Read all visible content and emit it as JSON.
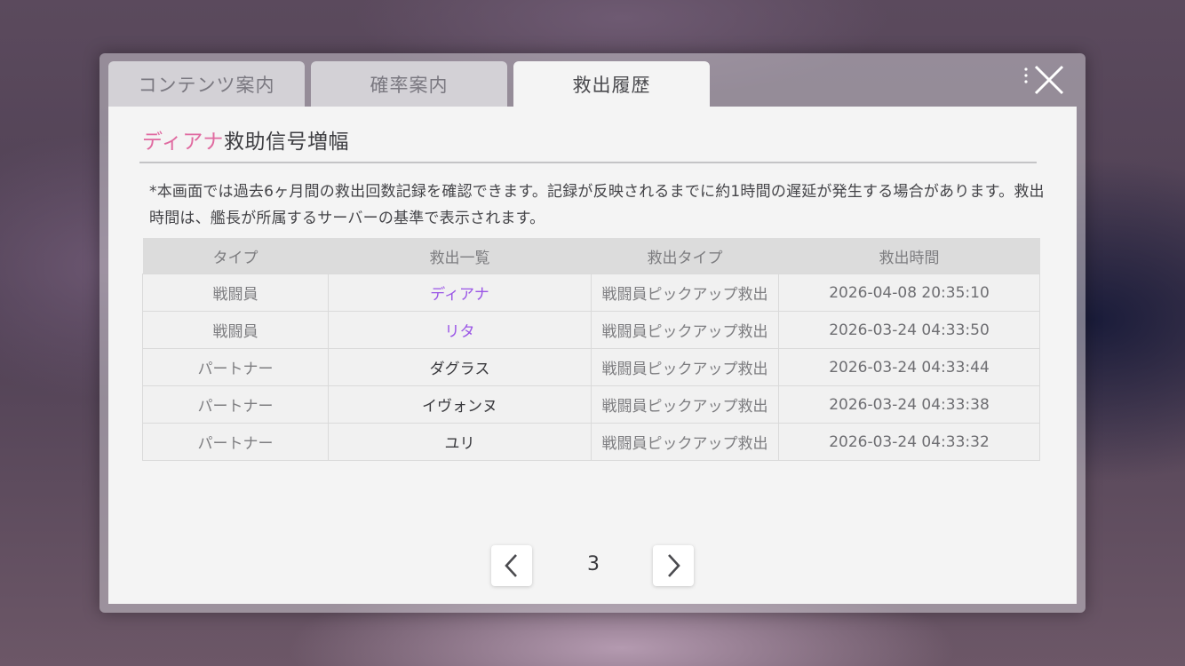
{
  "tabs": [
    {
      "label": "コンテンツ案内",
      "active": false
    },
    {
      "label": "確率案内",
      "active": false
    },
    {
      "label": "救出履歴",
      "active": true
    }
  ],
  "title": {
    "highlight": "ディアナ",
    "rest": "救助信号増幅"
  },
  "notice": "*本画面では過去6ヶ月間の救出回数記録を確認できます。記録が反映されるまでに約1時間の遅延が発生する場合があります。救出時間は、艦長が所属するサーバーの基準で表示されます。",
  "table": {
    "headers": [
      "タイプ",
      "救出一覧",
      "救出タイプ",
      "救出時間"
    ],
    "rows": [
      {
        "type": "戦闘員",
        "name": "ディアナ",
        "rescue_type": "戦闘員ピックアップ救出",
        "time": "2026-04-08 20:35:10",
        "highlight": true
      },
      {
        "type": "戦闘員",
        "name": "リタ",
        "rescue_type": "戦闘員ピックアップ救出",
        "time": "2026-03-24 04:33:50",
        "highlight": true
      },
      {
        "type": "パートナー",
        "name": "ダグラス",
        "rescue_type": "戦闘員ピックアップ救出",
        "time": "2026-03-24 04:33:44",
        "highlight": false
      },
      {
        "type": "パートナー",
        "name": "イヴォンヌ",
        "rescue_type": "戦闘員ピックアップ救出",
        "time": "2026-03-24 04:33:38",
        "highlight": false
      },
      {
        "type": "パートナー",
        "name": "ユリ",
        "rescue_type": "戦闘員ピックアップ救出",
        "time": "2026-03-24 04:33:32",
        "highlight": false
      }
    ]
  },
  "pagination": {
    "page": "3"
  },
  "colors": {
    "title_highlight": "#e06aa0",
    "name_highlight": "#9a55e6"
  },
  "icons": {
    "close": "close-icon",
    "prev": "chevron-left-icon",
    "next": "chevron-right-icon"
  }
}
